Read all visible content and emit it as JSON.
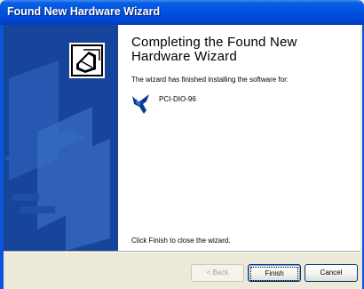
{
  "window": {
    "title": "Found New Hardware Wizard"
  },
  "heading": "Completing the Found New Hardware Wizard",
  "description": "The wizard has finished installing the software for:",
  "device": {
    "name": "PCI-DIO-96",
    "icon": "ni-eagle-icon"
  },
  "footer_text": "Click Finish to close the wizard.",
  "buttons": {
    "back": "< Back",
    "finish": "Finish",
    "cancel": "Cancel"
  },
  "colors": {
    "titlebar": "#0055e5",
    "side_panel": "#17459c",
    "dialog_bg": "#ece9d8"
  }
}
